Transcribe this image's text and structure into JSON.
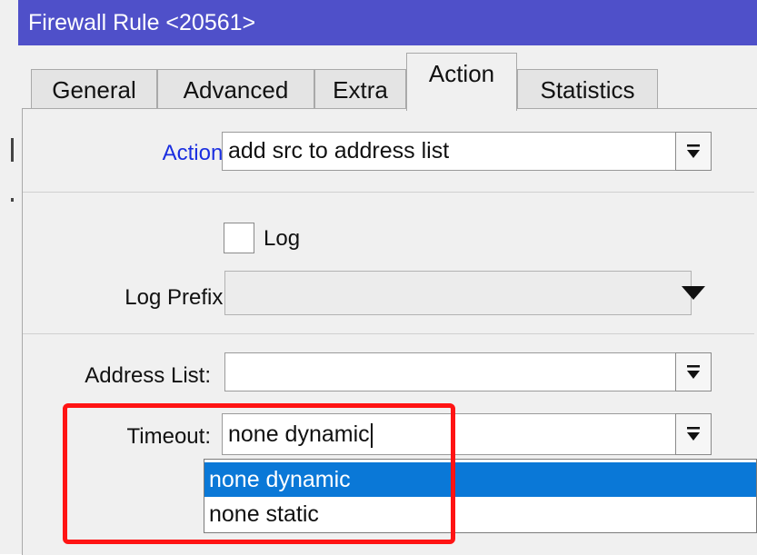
{
  "window": {
    "title": "Firewall Rule <20561>"
  },
  "tabs": [
    {
      "label": "General"
    },
    {
      "label": "Advanced"
    },
    {
      "label": "Extra"
    },
    {
      "label": "Action"
    },
    {
      "label": "Statistics"
    }
  ],
  "active_tab": "Action",
  "form": {
    "action": {
      "label": "Action:",
      "value": "add src to address list"
    },
    "log": {
      "label": "Log",
      "checked": false
    },
    "log_prefix": {
      "label": "Log Prefix:",
      "value": ""
    },
    "address_list": {
      "label": "Address List:",
      "value": ""
    },
    "timeout": {
      "label": "Timeout:",
      "value": "none dynamic",
      "options": [
        "none dynamic",
        "none static"
      ],
      "highlighted_option": "none dynamic"
    }
  },
  "colors": {
    "titlebar": "#4f50c9",
    "action_label": "#1a2ee0",
    "selection": "#0a78d7",
    "highlight_box": "#ff1414"
  },
  "icons": {
    "dropdown_button": "dropdown-arrow-bar-icon",
    "expand_arrow": "triangle-down-icon"
  }
}
